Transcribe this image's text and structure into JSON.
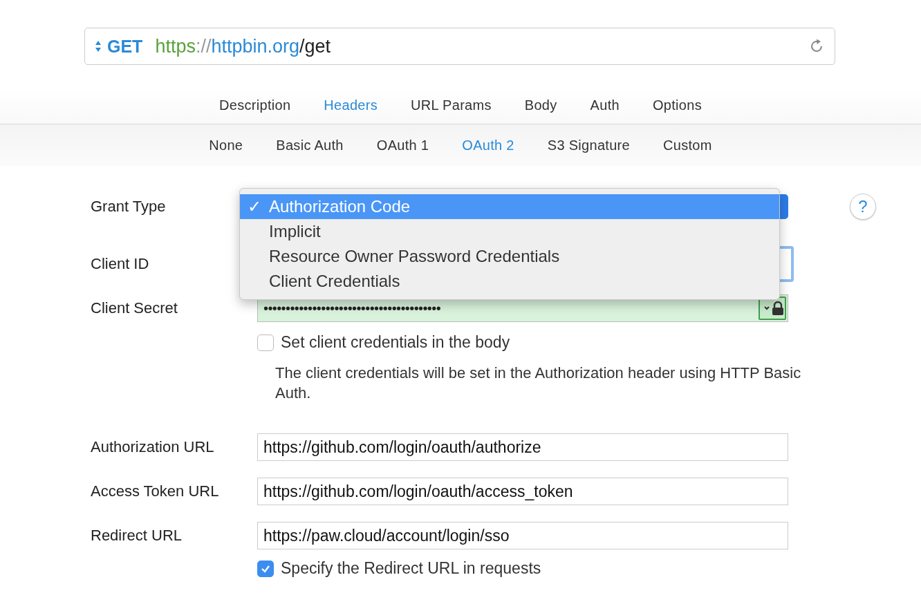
{
  "url_bar": {
    "method": "GET",
    "url_parts": [
      {
        "kind": "scheme",
        "text": "https"
      },
      {
        "kind": "separator",
        "text": "://"
      },
      {
        "kind": "host",
        "text": "httpbin.org"
      },
      {
        "kind": "path",
        "text": "/get"
      }
    ]
  },
  "tabs": [
    {
      "label": "Description",
      "selected": false
    },
    {
      "label": "Headers",
      "selected": true
    },
    {
      "label": "URL Params",
      "selected": false
    },
    {
      "label": "Body",
      "selected": false
    },
    {
      "label": "Auth",
      "selected": false
    },
    {
      "label": "Options",
      "selected": false
    }
  ],
  "auth_tabs": [
    {
      "label": "None",
      "selected": false
    },
    {
      "label": "Basic Auth",
      "selected": false
    },
    {
      "label": "OAuth 1",
      "selected": false
    },
    {
      "label": "OAuth 2",
      "selected": true
    },
    {
      "label": "S3 Signature",
      "selected": false
    },
    {
      "label": "Custom",
      "selected": false
    }
  ],
  "grant_type": {
    "label": "Grant Type",
    "help": "?",
    "menu": {
      "check_mark": "✓",
      "options": [
        {
          "label": "Authorization Code",
          "selected": true
        },
        {
          "label": "Implicit",
          "selected": false
        },
        {
          "label": "Resource Owner Password Credentials",
          "selected": false
        },
        {
          "label": "Client Credentials",
          "selected": false
        }
      ]
    }
  },
  "client_id": {
    "label": "Client ID",
    "focused": true
  },
  "client_secret": {
    "label": "Client Secret",
    "value": "••••••••••••••••••••••••••••••••••••••••"
  },
  "credentials_in_body": {
    "label": "Set client credentials in the body",
    "checked": false,
    "hint": "The client credentials will be set in the Authorization header using HTTP Basic Auth."
  },
  "url_fields": [
    {
      "label": "Authorization URL",
      "value": "https://github.com/login/oauth/authorize"
    },
    {
      "label": "Access Token URL",
      "value": "https://github.com/login/oauth/access_token"
    },
    {
      "label": "Redirect URL",
      "value": "https://paw.cloud/account/login/sso"
    }
  ],
  "redirect_in_requests": {
    "label": "Specify the Redirect URL in requests",
    "checked": true
  }
}
